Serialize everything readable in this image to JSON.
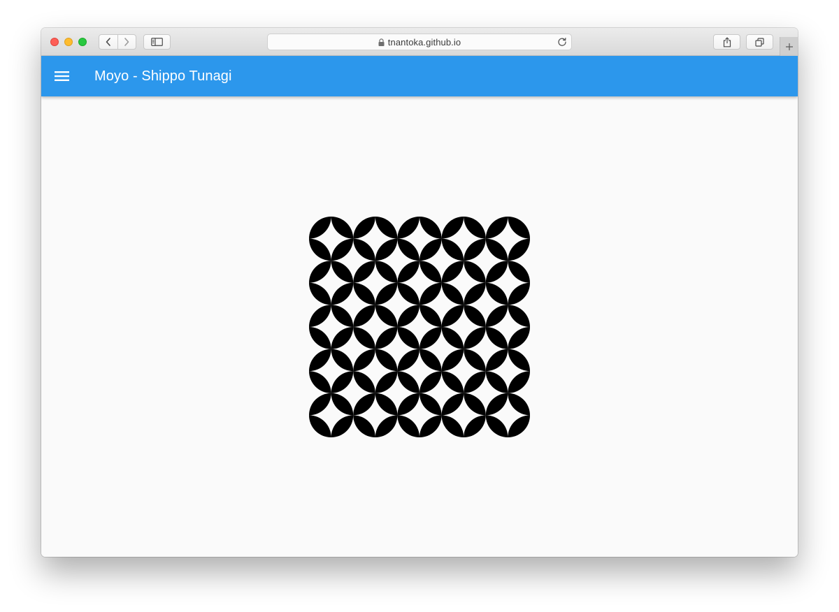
{
  "browser": {
    "url": "tnantoka.github.io",
    "icons": {
      "back": "chevron-left-icon",
      "forward": "chevron-right-icon",
      "sidebar": "sidebar-icon",
      "lock": "lock-icon",
      "reload": "reload-icon",
      "share": "share-icon",
      "tabs": "tabs-icon",
      "new_tab": "plus-icon"
    }
  },
  "app": {
    "title": "Moyo - Shippo Tunagi",
    "menu_icon": "hamburger-menu-icon",
    "accent": "#2c97ec"
  },
  "pattern": {
    "name": "Shippo Tunagi",
    "rows": 5,
    "cols": 5,
    "fill": "#000000",
    "background": "#fafafa"
  }
}
